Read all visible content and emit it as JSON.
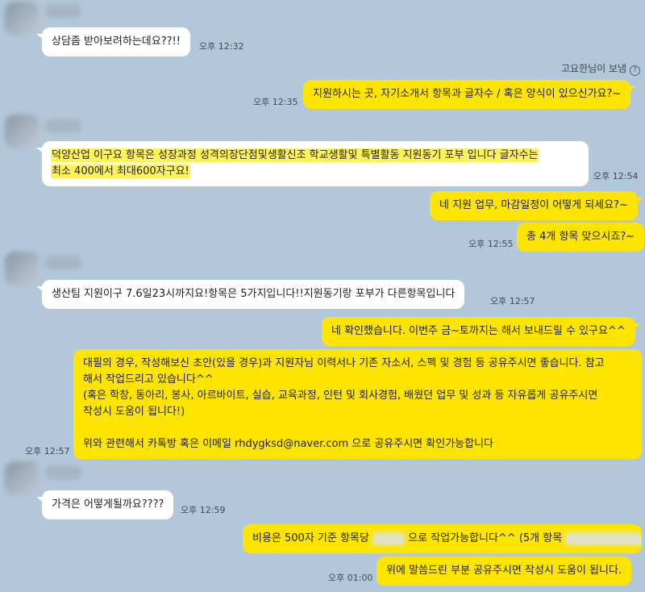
{
  "share_note": {
    "label": "고요한님이 보냄",
    "icon": "?"
  },
  "messages": [
    {
      "id": "m1",
      "side": "in",
      "text": "상담좀 받아보려하는데요??!!",
      "time": "오후 12:32"
    },
    {
      "id": "m2",
      "side": "out",
      "text": "지원하시는 곳, 자기소개서 항목과 글자수 / 혹은 양식이 있으신가요?~",
      "time": "오후 12:35"
    },
    {
      "id": "m3",
      "side": "in",
      "lines": [
        "덕양산업 이구요 항목은 성장과정 성격의장단점및생활신조 학교생활및 특별활동 지원동기 포부 입니다 글자수는",
        "최소 400에서 최대600자구요!"
      ],
      "time": "오후 12:54"
    },
    {
      "id": "m4",
      "side": "out",
      "text": "네 지원 업무, 마감일정이 어떻게 되세요?~",
      "time": ""
    },
    {
      "id": "m5",
      "side": "out",
      "text": "총 4개 항목 맞으시죠?~",
      "time": "오후 12:55"
    },
    {
      "id": "m6",
      "side": "in",
      "text": "생산팀 지원이구 7.6일23시까지요!항목은 5가지입니다!!지원동기랑 포부가 다른항목입니다",
      "time": "오후 12:57"
    },
    {
      "id": "m7",
      "side": "out",
      "text": "네 확인했습니다. 이번주 금~토까지는 해서 보내드릴 수 있구요^^",
      "time": ""
    },
    {
      "id": "m8",
      "side": "out",
      "lines": [
        "대필의 경우, 작성해보신 초안(있을 경우)과 지원자님 이력서나 기존 자소서, 스펙 및 경험 등 공유주시면 좋습니다. 참고",
        "해서 작업드리고 있습니다^^",
        "(혹은 학창, 동아리, 봉사, 아르바이트, 실습, 교육과정, 인턴 및 회사경험, 배웠던 업무 및 성과 등 자유롭게 공유주시면",
        "작성시 도움이 됩니다!)",
        "",
        "위와 관련해서 카톡방 혹은 이메일 rhdygksd@naver.com 으로 공유주시면 확인가능합니다"
      ],
      "time": "오후 12:57"
    },
    {
      "id": "m9",
      "side": "in",
      "text": "가격은 어떻게될까요????",
      "time": "오후 12:59"
    },
    {
      "id": "m10",
      "side": "out",
      "text_a": "비용은 500자 기준 항목당",
      "text_b": "으로 작업가능합니다^^ (5개 항목",
      "time": ""
    },
    {
      "id": "m11",
      "side": "out",
      "text": "위에 말씀드린 부분 공유주시면 작성시 도움이 됩니다.",
      "time": "오후 01:00"
    }
  ],
  "colors": {
    "background": "#b2c7d9",
    "incoming_bubble": "#ffffff",
    "outgoing_bubble": "#fee500",
    "highlight": "#fff25a"
  },
  "icons": {
    "avatar": "profile-avatar-blurred",
    "help": "question-circle-icon"
  }
}
